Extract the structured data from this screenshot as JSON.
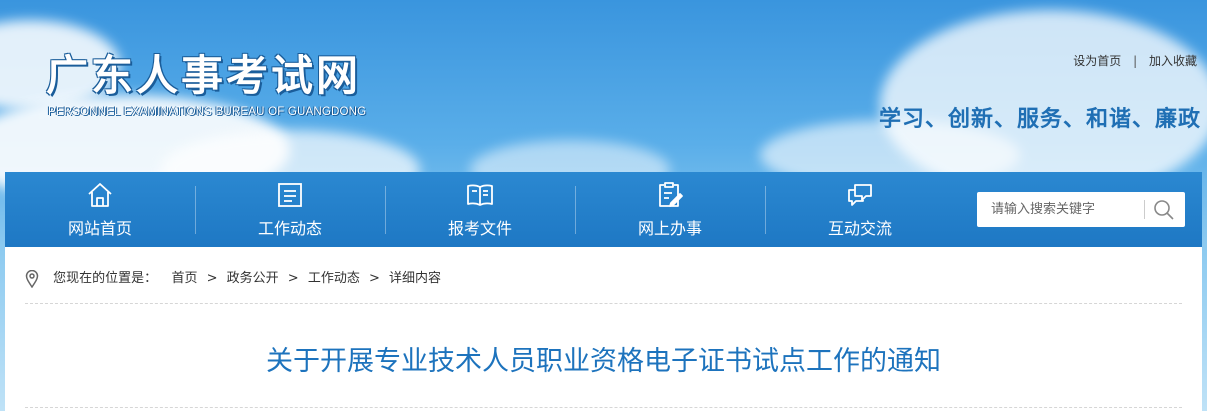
{
  "header": {
    "site_title": "广东人事考试网",
    "site_subtitle": "PERSONNEL EXAMINATIONS BUREAU OF GUANGDONG",
    "slogan": "学习、创新、服务、和谐、廉政",
    "links": {
      "set_home": "设为首页",
      "separator": "|",
      "add_favorite": "加入收藏"
    }
  },
  "nav": {
    "items": [
      {
        "label": "网站首页",
        "icon": "home-icon"
      },
      {
        "label": "工作动态",
        "icon": "document-list-icon"
      },
      {
        "label": "报考文件",
        "icon": "open-book-icon"
      },
      {
        "label": "网上办事",
        "icon": "clipboard-edit-icon"
      },
      {
        "label": "互动交流",
        "icon": "chat-bubbles-icon"
      }
    ],
    "search": {
      "placeholder": "请输入搜索关键字",
      "icon": "search-icon"
    }
  },
  "breadcrumb": {
    "prefix": "您现在的位置是：",
    "items": [
      "首页",
      "政务公开",
      "工作动态",
      "详细内容"
    ],
    "arrow": ">"
  },
  "article": {
    "title": "关于开展专业技术人员职业资格电子证书试点工作的通知"
  },
  "colors": {
    "nav_bg": "#1e78c4",
    "title_blue": "#1d73bd",
    "slogan_blue": "#1f6fb4"
  }
}
